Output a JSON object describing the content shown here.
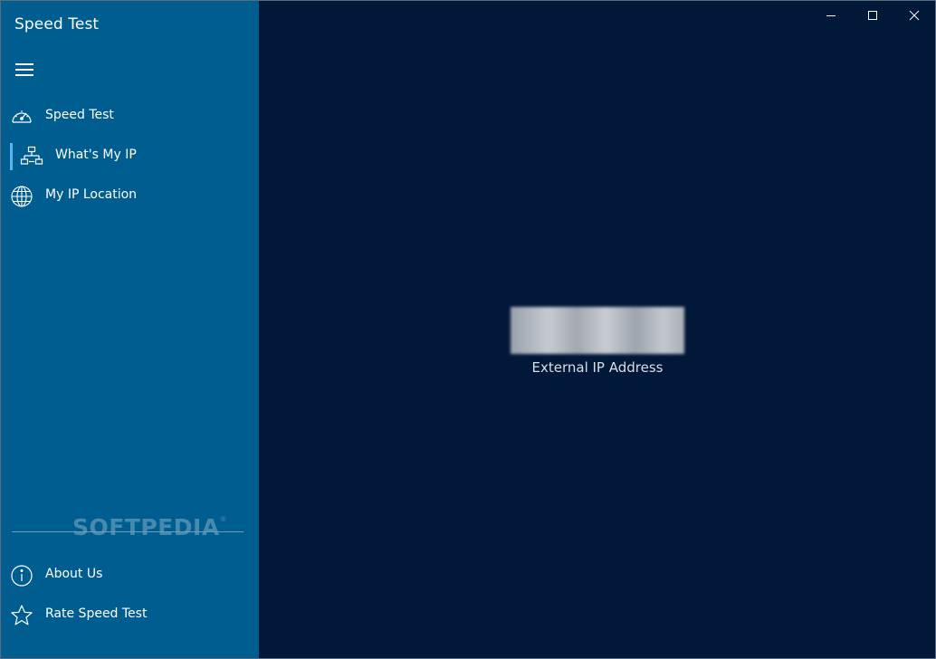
{
  "app": {
    "title": "Speed Test"
  },
  "sidebar": {
    "menu_icon": "hamburger-menu-icon",
    "items": [
      {
        "label": "Speed Test",
        "icon": "speedometer-icon",
        "selected": false
      },
      {
        "label": "What's My IP",
        "icon": "network-icon",
        "selected": true
      },
      {
        "label": "My IP Location",
        "icon": "globe-icon",
        "selected": false
      }
    ],
    "footer_items": [
      {
        "label": "About Us",
        "icon": "info-icon"
      },
      {
        "label": "Rate Speed Test",
        "icon": "star-icon"
      }
    ],
    "watermark": "SOFTPEDIA",
    "watermark_mark": "®"
  },
  "window_controls": {
    "minimize": "minimize-icon",
    "maximize": "maximize-icon",
    "close": "close-icon"
  },
  "main": {
    "ip_value": "",
    "ip_caption": "External IP Address"
  },
  "colors": {
    "sidebar_bg": "#005d8f",
    "main_bg": "#011839",
    "selection_accent": "#52b9f2"
  }
}
